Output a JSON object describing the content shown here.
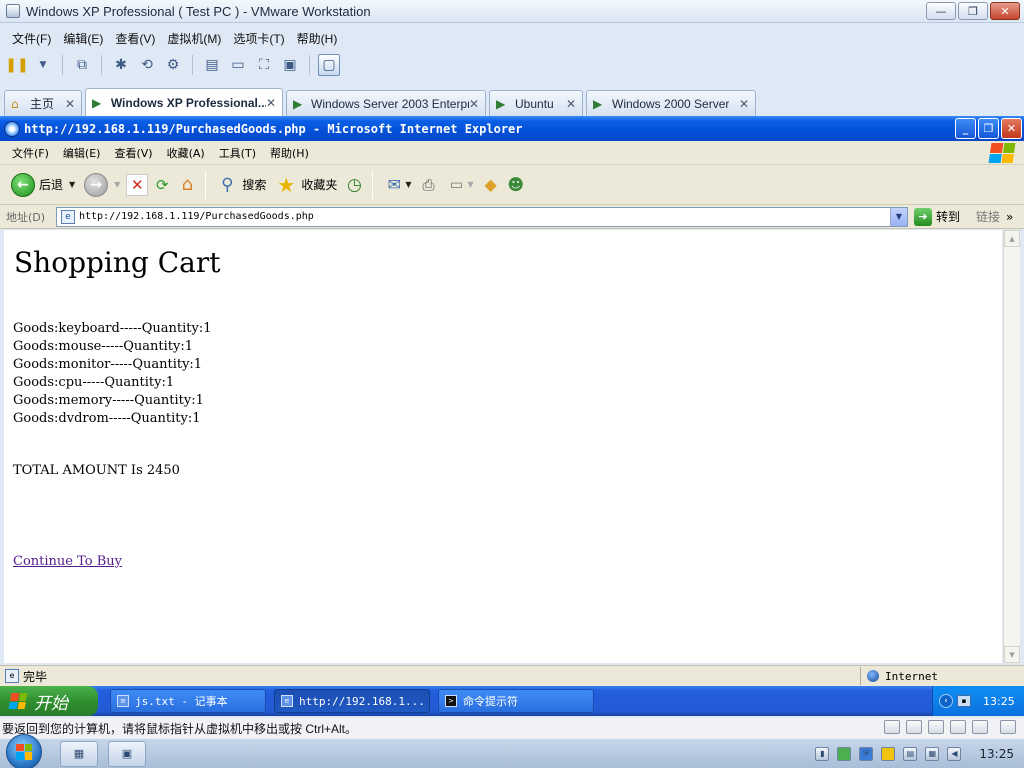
{
  "vmware": {
    "title": "Windows XP Professional ( Test PC ) - VMware Workstation",
    "menu": [
      "文件(F)",
      "编辑(E)",
      "查看(V)",
      "虚拟机(M)",
      "选项卡(T)",
      "帮助(H)"
    ],
    "tabs": [
      {
        "label": "主页",
        "active": false,
        "icon": "home-icon"
      },
      {
        "label": "Windows XP Professional...",
        "active": true,
        "icon": "vm-icon"
      },
      {
        "label": "Windows Server 2003 Enterpr...",
        "active": false,
        "icon": "vm-icon"
      },
      {
        "label": "Ubuntu",
        "active": false,
        "icon": "vm-icon"
      },
      {
        "label": "Windows 2000 Server",
        "active": false,
        "icon": "vm-icon"
      }
    ],
    "status_hint": "要返回到您的计算机，请将鼠标指针从虚拟机中移出或按 Ctrl+Alt。"
  },
  "ie": {
    "title": "http://192.168.1.119/PurchasedGoods.php - Microsoft Internet Explorer",
    "menu": [
      "文件(F)",
      "编辑(E)",
      "查看(V)",
      "收藏(A)",
      "工具(T)",
      "帮助(H)"
    ],
    "toolbar": {
      "back_label": "后退",
      "search_label": "搜索",
      "favorites_label": "收藏夹"
    },
    "address": {
      "label": "地址(D)",
      "url": "http://192.168.1.119/PurchasedGoods.php",
      "go_label": "转到",
      "links_label": "链接"
    },
    "status": {
      "text": "完毕",
      "zone": "Internet"
    }
  },
  "page": {
    "heading": "Shopping Cart",
    "goods": [
      "Goods:keyboard-----Quantity:1",
      "Goods:mouse-----Quantity:1",
      "Goods:monitor-----Quantity:1",
      "Goods:cpu-----Quantity:1",
      "Goods:memory-----Quantity:1",
      "Goods:dvdrom-----Quantity:1"
    ],
    "total": "TOTAL AMOUNT Is 2450",
    "continue_link": "Continue To Buy"
  },
  "xp_taskbar": {
    "start_label": "开始",
    "tasks": [
      {
        "label": "js.txt - 记事本",
        "active": false
      },
      {
        "label": "http://192.168.1...",
        "active": true
      },
      {
        "label": "命令提示符",
        "active": false
      }
    ],
    "clock": "13:25"
  },
  "host_taskbar": {
    "clock": "13:25"
  },
  "colors": {
    "xp_blue": "#0550d8",
    "xp_start_green": "#2f8f2f",
    "visited_link": "#551a8b"
  }
}
